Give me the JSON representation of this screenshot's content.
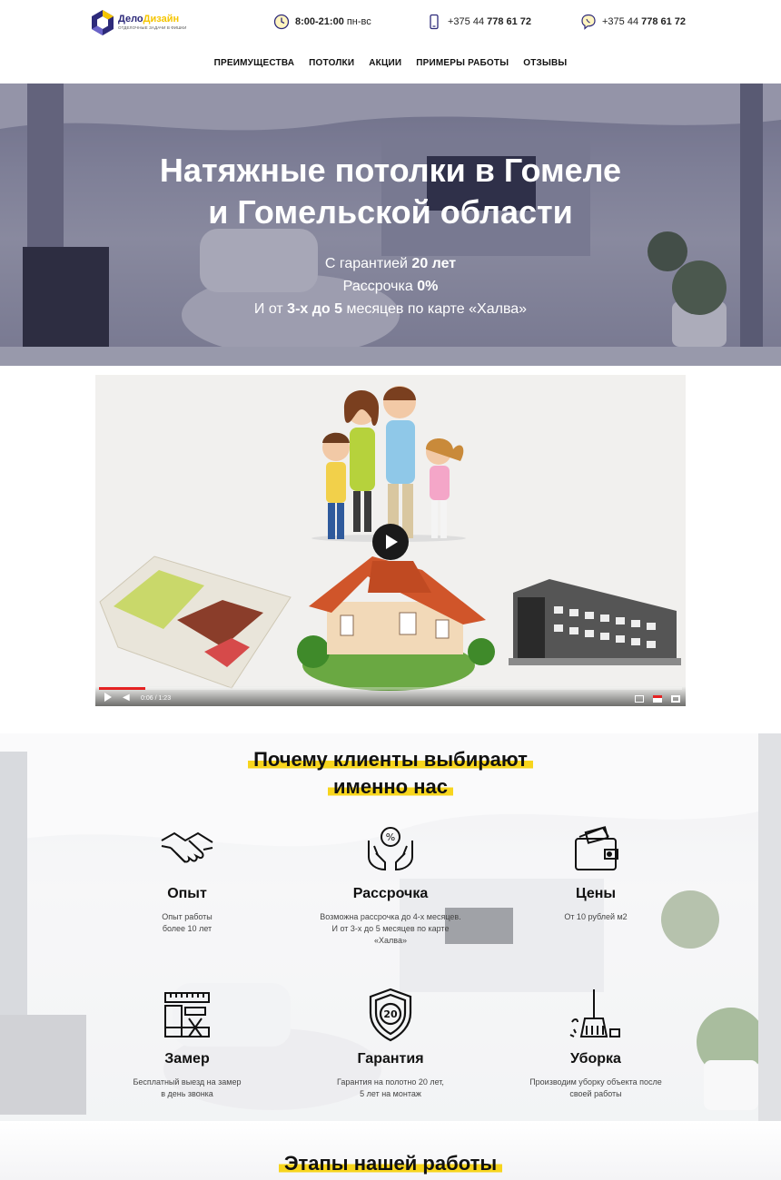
{
  "header": {
    "logo": {
      "title_main": "Дело",
      "title_accent": "Дизайн",
      "subtitle": "ОТДЕЛОЧНЫЕ ЗАДАЧИ В ФИШКИ"
    },
    "hours": {
      "bold": "8:00-21:00",
      "rest": "пн-вс"
    },
    "phone1": {
      "prefix": "+375 44",
      "number": "778 61 72"
    },
    "phone2": {
      "prefix": "+375 44",
      "number": "778 61 72"
    },
    "nav": [
      "ПРЕИМУЩЕСТВА",
      "ПОТОЛКИ",
      "АКЦИИ",
      "ПРИМЕРЫ РАБОТЫ",
      "ОТЗЫВЫ"
    ]
  },
  "hero": {
    "title_line1": "Натяжные потолки в Гомеле",
    "title_line2": "и Гомельской области",
    "line1_pre": "С гарантией ",
    "line1_bold": "20 лет",
    "line2_pre": "Рассрочка ",
    "line2_bold": "0%",
    "line3_pre": "И от ",
    "line3_bold": "3-х до 5",
    "line3_post": " месяцев по карте «Халва»"
  },
  "video": {
    "time": "0:06 / 1:23",
    "progress": 0.08
  },
  "advantages": {
    "title_line1": "Почему клиенты выбирают",
    "title_line2": "именно нас",
    "items": [
      {
        "icon": "handshake-icon",
        "title": "Опыт",
        "text": "Опыт работы\nболее 10 лет"
      },
      {
        "icon": "hands-percent-icon",
        "title": "Рассрочка",
        "text": "Возможна рассрочка до 4-х месяцев.\nИ от 3-х до 5 месяцев по карте\n«Халва»"
      },
      {
        "icon": "wallet-icon",
        "title": "Цены",
        "text": "От 10 рублей м2"
      },
      {
        "icon": "measure-tools-icon",
        "title": "Замер",
        "text": "Бесплатный выезд на замер\nв день звонка"
      },
      {
        "icon": "shield-20-icon",
        "title": "Гарантия",
        "text": "Гарантия на полотно 20 лет,\n5 лет на монтаж"
      },
      {
        "icon": "broom-icon",
        "title": "Уборка",
        "text": "Производим уборку объекта после\nсвоей работы"
      }
    ]
  },
  "steps": {
    "title": "Этапы нашей работы"
  },
  "colors": {
    "accent_yellow": "#f7d51d",
    "brand_navy": "#2d2a7a",
    "video_progress": "#e52222"
  }
}
